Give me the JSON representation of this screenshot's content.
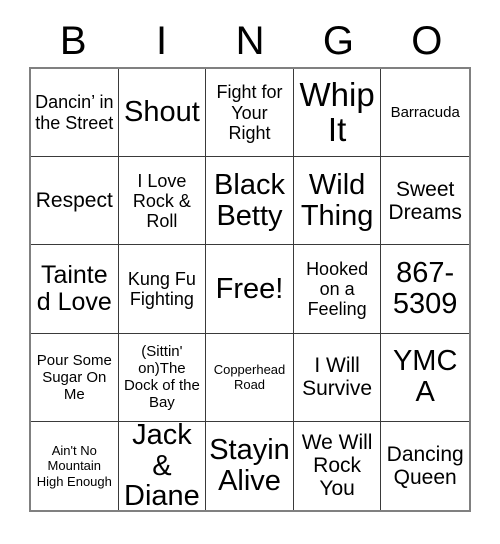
{
  "card": {
    "header_letters": [
      "B",
      "I",
      "N",
      "G",
      "O"
    ],
    "columns": 5,
    "rows": 5,
    "border_color": "#808080",
    "grid_line_color": "#3a3a3a",
    "background_color": "#ffffff",
    "text_color": "#000000",
    "free_space_label": "Free!",
    "cells": [
      {
        "text": "Dancin’ in the Street",
        "size": "md"
      },
      {
        "text": "Shout",
        "size": "2xl"
      },
      {
        "text": "Fight for Your Right",
        "size": "md"
      },
      {
        "text": "Whip It",
        "size": "3xl"
      },
      {
        "text": "Barracuda",
        "size": "sm"
      },
      {
        "text": "Respect",
        "size": "lg"
      },
      {
        "text": "I Love Rock & Roll",
        "size": "md"
      },
      {
        "text": "Black Betty",
        "size": "2xl"
      },
      {
        "text": "Wild Thing",
        "size": "2xl"
      },
      {
        "text": "Sweet Dreams",
        "size": "lg"
      },
      {
        "text": "Tainted Love",
        "size": "xl"
      },
      {
        "text": "Kung Fu Fighting",
        "size": "md"
      },
      {
        "text": "Free!",
        "size": "2xl"
      },
      {
        "text": "Hooked on a Feeling",
        "size": "md"
      },
      {
        "text": "867-5309",
        "size": "2xl"
      },
      {
        "text": "Pour Some Sugar On Me",
        "size": "sm"
      },
      {
        "text": "(Sittin' on)The Dock of the Bay",
        "size": "sm"
      },
      {
        "text": "Copperhead Road",
        "size": "xs"
      },
      {
        "text": "I Will Survive",
        "size": "lg"
      },
      {
        "text": "YMCA",
        "size": "2xl"
      },
      {
        "text": "Ain't No Mountain High Enough",
        "size": "xs"
      },
      {
        "text": "Jack & Diane",
        "size": "2xl"
      },
      {
        "text": "Stayin Alive",
        "size": "2xl"
      },
      {
        "text": "We Will Rock You",
        "size": "lg"
      },
      {
        "text": "Dancing Queen",
        "size": "lg"
      }
    ]
  }
}
